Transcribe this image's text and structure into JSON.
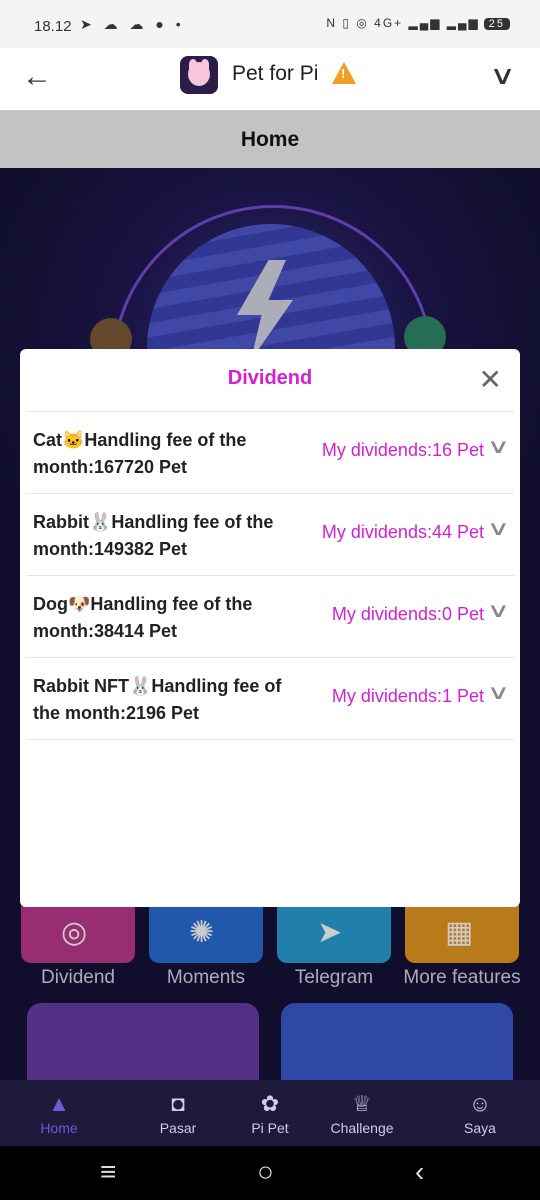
{
  "status": {
    "time": "18.12",
    "network": "4G+",
    "battery": "25"
  },
  "titlebar": {
    "app_title": "Pet for Pi"
  },
  "page": {
    "title": "Home"
  },
  "modal": {
    "title": "Dividend",
    "rows": [
      {
        "label": "Cat🐱Handling fee of the month:167720 Pet",
        "dividend": "My dividends:16 Pet"
      },
      {
        "label": "Rabbit🐰Handling fee of the month:149382 Pet",
        "dividend": "My dividends:44 Pet"
      },
      {
        "label": "Dog🐶Handling fee of the month:38414 Pet",
        "dividend": "My dividends:0 Pet"
      },
      {
        "label": "Rabbit NFT🐰Handling fee of the month:2196 Pet",
        "dividend": "My dividends:1 Pet"
      }
    ]
  },
  "features": [
    {
      "label": "Dividend",
      "icon": "nft-icon",
      "color": "#c0398f"
    },
    {
      "label": "Moments",
      "icon": "aperture-icon",
      "color": "#2a6fd6"
    },
    {
      "label": "Telegram",
      "icon": "paper-plane-icon",
      "color": "#2a9fd6"
    },
    {
      "label": "More features",
      "icon": "grid-icon",
      "color": "#e89a20"
    }
  ],
  "bottom_nav": [
    {
      "label": "Home",
      "icon": "home-icon",
      "active": true
    },
    {
      "label": "Pasar",
      "icon": "bag-icon"
    },
    {
      "label": "Pi Pet",
      "icon": "paw-icon"
    },
    {
      "label": "Challenge",
      "icon": "trophy-icon"
    },
    {
      "label": "Saya",
      "icon": "person-icon"
    }
  ],
  "colors": {
    "accent": "#d61fd6",
    "nav_active": "#6a5ad8",
    "header_bg": "#c3c3c3"
  }
}
